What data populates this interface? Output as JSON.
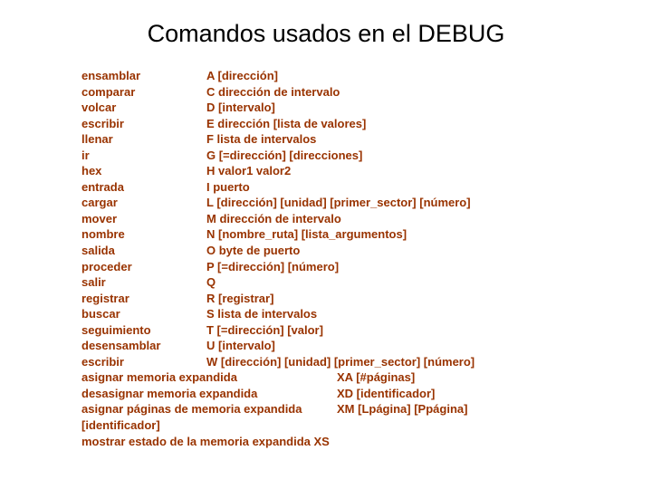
{
  "title": "Comandos usados en el DEBUG",
  "rows": [
    {
      "name": "ensamblar",
      "syntax": "A [dirección]"
    },
    {
      "name": "comparar",
      "syntax": "C dirección de intervalo"
    },
    {
      "name": "volcar",
      "syntax": "D [intervalo]"
    },
    {
      "name": "escribir",
      "syntax": "E dirección [lista de valores]"
    },
    {
      "name": "llenar",
      "syntax": "F lista de intervalos"
    },
    {
      "name": "ir",
      "syntax": "G [=dirección] [direcciones]"
    },
    {
      "name": "hex",
      "syntax": "H valor1 valor2"
    },
    {
      "name": "entrada",
      "syntax": "I puerto"
    },
    {
      "name": "cargar",
      "syntax": "L [dirección] [unidad] [primer_sector] [número]"
    },
    {
      "name": "mover",
      "syntax": "M dirección de intervalo"
    },
    {
      "name": "nombre",
      "syntax": "N [nombre_ruta] [lista_argumentos]"
    },
    {
      "name": "salida",
      "syntax": "O byte de puerto"
    },
    {
      "name": "proceder",
      "syntax": "P [=dirección] [número]"
    },
    {
      "name": "salir",
      "syntax": "Q"
    },
    {
      "name": "registrar",
      "syntax": "R [registrar]"
    },
    {
      "name": "buscar",
      "syntax": "S lista de intervalos"
    },
    {
      "name": "seguimiento",
      "syntax": "T [=dirección] [valor]"
    },
    {
      "name": "desensamblar",
      "syntax": "U [intervalo]"
    },
    {
      "name": "escribir",
      "syntax": "W [dirección] [unidad] [primer_sector] [número]"
    }
  ],
  "long_rows": [
    {
      "name": "asignar memoria expandida",
      "syntax": "XA [#páginas]"
    },
    {
      "name": "desasignar memoria expandida",
      "syntax": "XD [identificador]"
    },
    {
      "name": "asignar páginas de memoria expandida",
      "syntax": "XM [Lpágina] [Ppágina]"
    }
  ],
  "tail": [
    "[identificador]",
    "mostrar estado de la memoria expandida XS"
  ]
}
